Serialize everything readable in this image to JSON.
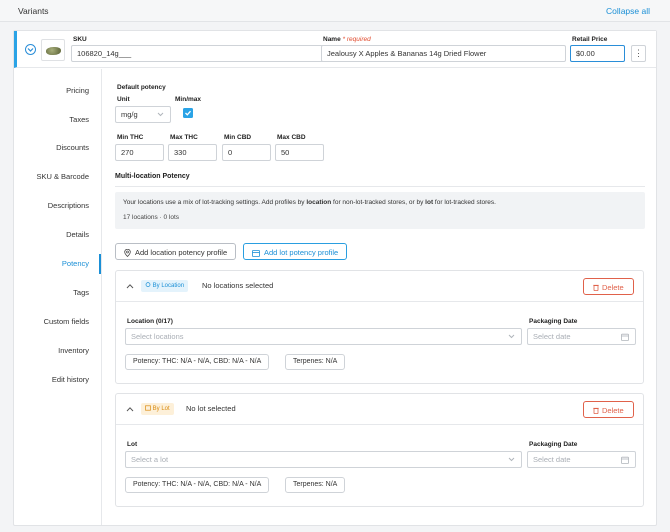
{
  "header": {
    "title": "Variants",
    "collapse_label": "Collapse all"
  },
  "variant": {
    "sku_label": "SKU",
    "sku_value": "106820_14g___",
    "name_label": "Name",
    "name_required": "* required",
    "name_value": "Jealousy X Apples & Bananas 14g Dried Flower",
    "price_label": "Retail Price",
    "price_value": "$0.00",
    "more_icon": "⋮"
  },
  "sidebar": {
    "items": [
      {
        "label": "Pricing"
      },
      {
        "label": "Taxes"
      },
      {
        "label": "Discounts"
      },
      {
        "label": "SKU & Barcode"
      },
      {
        "label": "Descriptions"
      },
      {
        "label": "Details"
      },
      {
        "label": "Potency"
      },
      {
        "label": "Tags"
      },
      {
        "label": "Custom fields"
      },
      {
        "label": "Inventory"
      },
      {
        "label": "Edit history"
      }
    ],
    "active": "Potency"
  },
  "potency": {
    "default_title": "Default potency",
    "unit_label": "Unit",
    "unit_value": "mg/g",
    "minmax_label": "Min/max",
    "minmax_checked": true,
    "min_thc_label": "Min THC",
    "min_thc_value": "270",
    "max_thc_label": "Max THC",
    "max_thc_value": "330",
    "min_cbd_label": "Min CBD",
    "min_cbd_value": "0",
    "max_cbd_label": "Max CBD",
    "max_cbd_value": "50",
    "multi_title": "Multi-location Potency",
    "info_pre": "Your locations use a mix of lot-tracking settings. Add profiles by ",
    "info_loc": "location",
    "info_mid": " for non-lot-tracked stores, or by ",
    "info_lot": "lot",
    "info_post": " for lot-tracked stores.",
    "info_count": "17 locations · 0 lots",
    "add_location_btn": "Add location potency profile",
    "add_lot_btn": "Add lot potency profile"
  },
  "location_profile": {
    "badge": "By Location",
    "status": "No locations selected",
    "delete_label": "Delete",
    "field_label": "Location (0/17)",
    "field_placeholder": "Select locations",
    "date_label": "Packaging Date",
    "date_placeholder": "Select date",
    "potency_tag": "Potency: THC: N/A - N/A, CBD: N/A - N/A",
    "terpenes_tag": "Terpenes: N/A"
  },
  "lot_profile": {
    "badge": "By Lot",
    "status": "No lot selected",
    "delete_label": "Delete",
    "field_label": "Lot",
    "field_placeholder": "Select a lot",
    "date_label": "Packaging Date",
    "date_placeholder": "Select date",
    "potency_tag": "Potency: THC: N/A - N/A, CBD: N/A - N/A",
    "terpenes_tag": "Terpenes: N/A"
  },
  "colors": {
    "accent": "#1a8fd6",
    "danger": "#e0614a",
    "lot_badge": "#d98b10"
  }
}
